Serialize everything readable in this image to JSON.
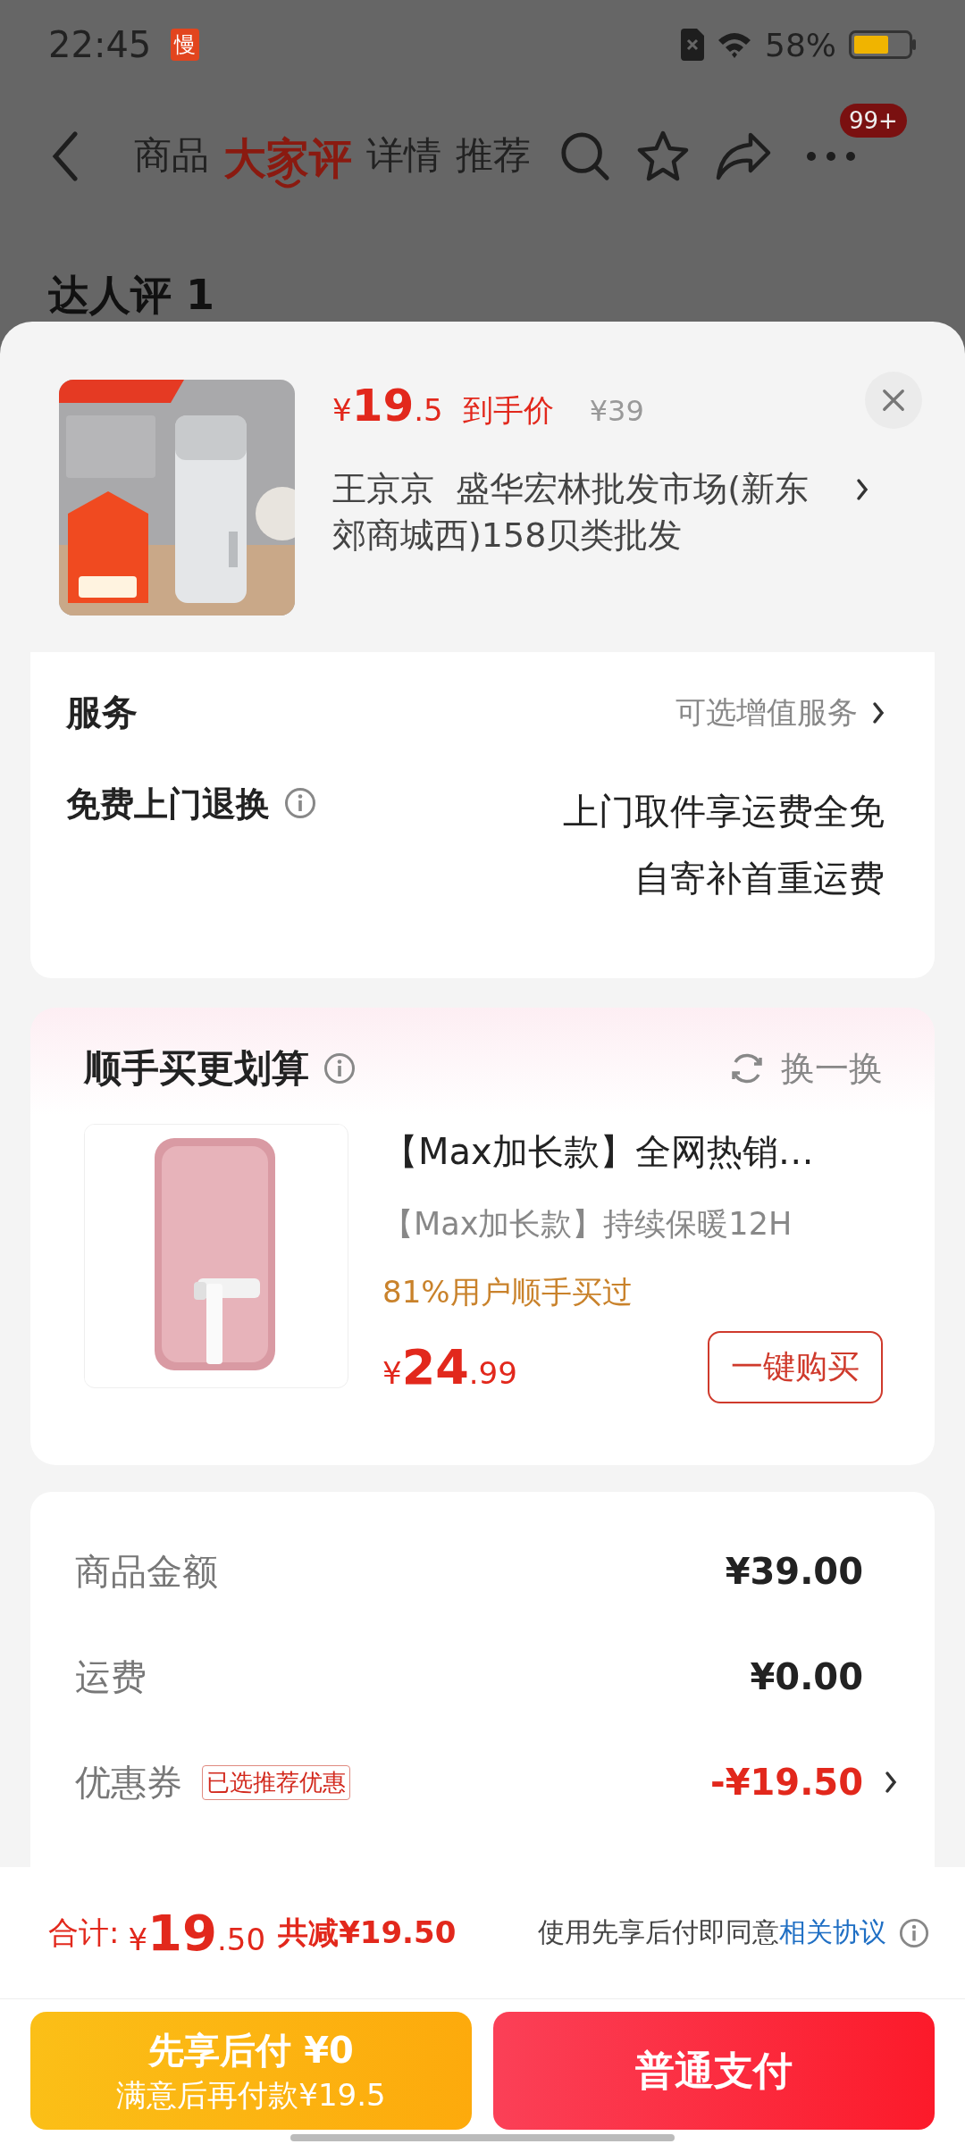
{
  "status_bar": {
    "time": "22:45",
    "app_badge": "慢",
    "battery": "58%"
  },
  "nav": {
    "tabs": [
      {
        "label": "商品",
        "selected": false
      },
      {
        "label": "大家评",
        "selected": true
      },
      {
        "label": "详情",
        "selected": false
      },
      {
        "label": "推荐",
        "selected": false
      }
    ],
    "badge": "99+"
  },
  "background_heading": "达人评 1",
  "product": {
    "kind": "picture",
    "price_symbol": "¥",
    "price_int": "19",
    "price_dec": ".5",
    "price_label": "到手价",
    "original_price": "¥39",
    "seller": "王京京  盛华宏林批发市场(新东郊商城西)158贝类批发"
  },
  "services": {
    "title": "服务",
    "link": "可选增值服务",
    "items": [
      {
        "name": "免费上门退换",
        "lines": [
          "上门取件享运费全免",
          "自寄补首重运费"
        ]
      }
    ]
  },
  "addon": {
    "title": "顺手买更划算",
    "refresh": "换一换",
    "item": {
      "kind": "picture",
      "title": "【Max加长款】全网热销…",
      "subtitle": "【Max加长款】持续保暖12H",
      "social": "81%用户顺手买过",
      "price_symbol": "¥",
      "price_int": "24",
      "price_dec": ".99",
      "button": "一键购买"
    }
  },
  "summary": [
    {
      "kind": "plain",
      "label": "商品金额",
      "value": "¥39.00"
    },
    {
      "kind": "plain",
      "label": "运费",
      "value": "¥0.00"
    },
    {
      "kind": "discount",
      "label": "优惠券",
      "tag": "已选推荐优惠",
      "value": "-¥19.50"
    }
  ],
  "footer": {
    "total_label": "合计:",
    "total_symbol": "¥",
    "total_int": "19",
    "total_dec": ".50",
    "saved": "共减¥19.50",
    "agreement": "使用先享后付即同意",
    "agreement_link": "相关协议",
    "pay_later": {
      "title": "先享后付 ¥0",
      "subtitle": "满意后再付款¥19.5"
    },
    "pay_now": "普通支付"
  }
}
